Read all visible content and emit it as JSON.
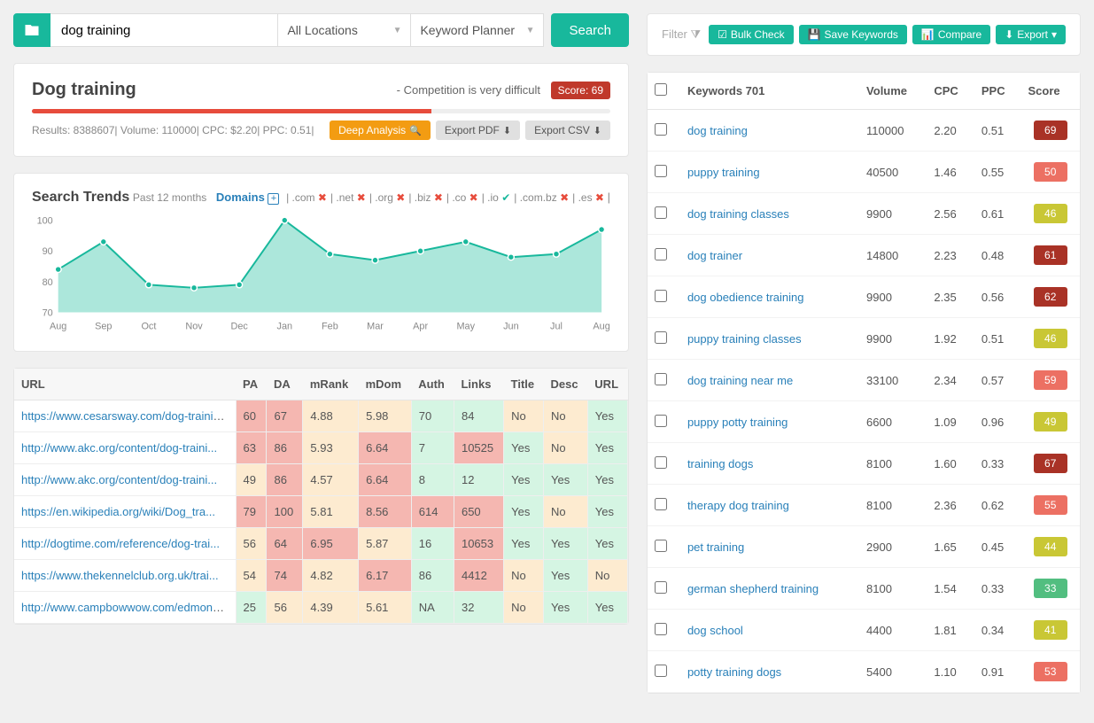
{
  "search": {
    "value": "dog training",
    "location": "All Locations",
    "tool": "Keyword Planner",
    "button": "Search"
  },
  "summary": {
    "title": "Dog training",
    "competition": "- Competition is very difficult",
    "score_label": "Score: 69",
    "results": "Results: 8388607",
    "volume": "Volume: 110000",
    "cpc": "CPC: $2.20",
    "ppc": "PPC: 0.51",
    "deep": "Deep Analysis",
    "export_pdf": "Export PDF",
    "export_csv": "Export CSV"
  },
  "trends": {
    "title": "Search Trends",
    "subtitle": "Past 12 months",
    "domains_label": "Domains",
    "tlds": [
      {
        "name": ".com",
        "mark": "✖",
        "cls": "x-red"
      },
      {
        "name": ".net",
        "mark": "✖",
        "cls": "x-red"
      },
      {
        "name": ".org",
        "mark": "✖",
        "cls": "x-red"
      },
      {
        "name": ".biz",
        "mark": "✖",
        "cls": "x-red"
      },
      {
        "name": ".co",
        "mark": "✖",
        "cls": "x-red"
      },
      {
        "name": ".io",
        "mark": "✔",
        "cls": "x-green"
      },
      {
        "name": ".com.bz",
        "mark": "✖",
        "cls": "x-red"
      },
      {
        "name": ".es",
        "mark": "✖",
        "cls": "x-red"
      }
    ]
  },
  "chart_data": {
    "type": "area",
    "title": "Search Trends",
    "xlabel": "",
    "ylabel": "",
    "ylim": [
      70,
      100
    ],
    "categories": [
      "Aug",
      "Sep",
      "Oct",
      "Nov",
      "Dec",
      "Jan",
      "Feb",
      "Mar",
      "Apr",
      "May",
      "Jun",
      "Jul",
      "Aug"
    ],
    "values": [
      84,
      93,
      79,
      78,
      79,
      100,
      89,
      87,
      90,
      93,
      88,
      89,
      97
    ]
  },
  "url_table": {
    "headers": [
      "URL",
      "PA",
      "DA",
      "mRank",
      "mDom",
      "Auth",
      "Links",
      "Title",
      "Desc",
      "URL"
    ],
    "rows": [
      {
        "url": "https://www.cesarsway.com/dog-trainin...",
        "pa": "60",
        "da": "67",
        "mrank": "4.88",
        "mdom": "5.98",
        "auth": "70",
        "links": "84",
        "title": "No",
        "desc": "No",
        "url2": "Yes",
        "c": [
          "cell-red",
          "cell-red",
          "cell-yellow",
          "cell-yellow",
          "cell-green",
          "cell-green",
          "cell-yellow",
          "cell-yellow",
          "cell-green"
        ]
      },
      {
        "url": "http://www.akc.org/content/dog-traini...",
        "pa": "63",
        "da": "86",
        "mrank": "5.93",
        "mdom": "6.64",
        "auth": "7",
        "links": "10525",
        "title": "Yes",
        "desc": "No",
        "url2": "Yes",
        "c": [
          "cell-red",
          "cell-red",
          "cell-yellow",
          "cell-red",
          "cell-green",
          "cell-red",
          "cell-green",
          "cell-yellow",
          "cell-green"
        ]
      },
      {
        "url": "http://www.akc.org/content/dog-traini...",
        "pa": "49",
        "da": "86",
        "mrank": "4.57",
        "mdom": "6.64",
        "auth": "8",
        "links": "12",
        "title": "Yes",
        "desc": "Yes",
        "url2": "Yes",
        "c": [
          "cell-yellow",
          "cell-red",
          "cell-yellow",
          "cell-red",
          "cell-green",
          "cell-green",
          "cell-green",
          "cell-green",
          "cell-green"
        ]
      },
      {
        "url": "https://en.wikipedia.org/wiki/Dog_tra...",
        "pa": "79",
        "da": "100",
        "mrank": "5.81",
        "mdom": "8.56",
        "auth": "614",
        "links": "650",
        "title": "Yes",
        "desc": "No",
        "url2": "Yes",
        "c": [
          "cell-red",
          "cell-red",
          "cell-yellow",
          "cell-red",
          "cell-red",
          "cell-red",
          "cell-green",
          "cell-yellow",
          "cell-green"
        ]
      },
      {
        "url": "http://dogtime.com/reference/dog-trai...",
        "pa": "56",
        "da": "64",
        "mrank": "6.95",
        "mdom": "5.87",
        "auth": "16",
        "links": "10653",
        "title": "Yes",
        "desc": "Yes",
        "url2": "Yes",
        "c": [
          "cell-yellow",
          "cell-red",
          "cell-red",
          "cell-yellow",
          "cell-green",
          "cell-red",
          "cell-green",
          "cell-green",
          "cell-green"
        ]
      },
      {
        "url": "https://www.thekennelclub.org.uk/trai...",
        "pa": "54",
        "da": "74",
        "mrank": "4.82",
        "mdom": "6.17",
        "auth": "86",
        "links": "4412",
        "title": "No",
        "desc": "Yes",
        "url2": "No",
        "c": [
          "cell-yellow",
          "cell-red",
          "cell-yellow",
          "cell-red",
          "cell-green",
          "cell-red",
          "cell-yellow",
          "cell-green",
          "cell-yellow"
        ]
      },
      {
        "url": "http://www.campbowwow.com/edmond/serv...",
        "pa": "25",
        "da": "56",
        "mrank": "4.39",
        "mdom": "5.61",
        "auth": "NA",
        "links": "32",
        "title": "No",
        "desc": "Yes",
        "url2": "Yes",
        "c": [
          "cell-green",
          "cell-yellow",
          "cell-yellow",
          "cell-yellow",
          "cell-green",
          "cell-green",
          "cell-yellow",
          "cell-green",
          "cell-green"
        ]
      }
    ]
  },
  "right": {
    "filter": "Filter",
    "bulk": "Bulk Check",
    "save": "Save Keywords",
    "compare": "Compare",
    "export": "Export"
  },
  "kw_table": {
    "headers": [
      "",
      "Keywords 701",
      "Volume",
      "CPC",
      "PPC",
      "Score"
    ],
    "rows": [
      {
        "kw": "dog training",
        "vol": "110000",
        "cpc": "2.20",
        "ppc": "0.51",
        "score": "69",
        "cls": "s-darkred"
      },
      {
        "kw": "puppy training",
        "vol": "40500",
        "cpc": "1.46",
        "ppc": "0.55",
        "score": "50",
        "cls": "s-red"
      },
      {
        "kw": "dog training classes",
        "vol": "9900",
        "cpc": "2.56",
        "ppc": "0.61",
        "score": "46",
        "cls": "s-yellow"
      },
      {
        "kw": "dog trainer",
        "vol": "14800",
        "cpc": "2.23",
        "ppc": "0.48",
        "score": "61",
        "cls": "s-darkred"
      },
      {
        "kw": "dog obedience training",
        "vol": "9900",
        "cpc": "2.35",
        "ppc": "0.56",
        "score": "62",
        "cls": "s-darkred"
      },
      {
        "kw": "puppy training classes",
        "vol": "9900",
        "cpc": "1.92",
        "ppc": "0.51",
        "score": "46",
        "cls": "s-yellow"
      },
      {
        "kw": "dog training near me",
        "vol": "33100",
        "cpc": "2.34",
        "ppc": "0.57",
        "score": "59",
        "cls": "s-red"
      },
      {
        "kw": "puppy potty training",
        "vol": "6600",
        "cpc": "1.09",
        "ppc": "0.96",
        "score": "49",
        "cls": "s-yellow"
      },
      {
        "kw": "training dogs",
        "vol": "8100",
        "cpc": "1.60",
        "ppc": "0.33",
        "score": "67",
        "cls": "s-darkred"
      },
      {
        "kw": "therapy dog training",
        "vol": "8100",
        "cpc": "2.36",
        "ppc": "0.62",
        "score": "55",
        "cls": "s-red"
      },
      {
        "kw": "pet training",
        "vol": "2900",
        "cpc": "1.65",
        "ppc": "0.45",
        "score": "44",
        "cls": "s-yellow"
      },
      {
        "kw": "german shepherd training",
        "vol": "8100",
        "cpc": "1.54",
        "ppc": "0.33",
        "score": "33",
        "cls": "s-green"
      },
      {
        "kw": "dog school",
        "vol": "4400",
        "cpc": "1.81",
        "ppc": "0.34",
        "score": "41",
        "cls": "s-yellow"
      },
      {
        "kw": "potty training dogs",
        "vol": "5400",
        "cpc": "1.10",
        "ppc": "0.91",
        "score": "53",
        "cls": "s-red"
      }
    ]
  }
}
